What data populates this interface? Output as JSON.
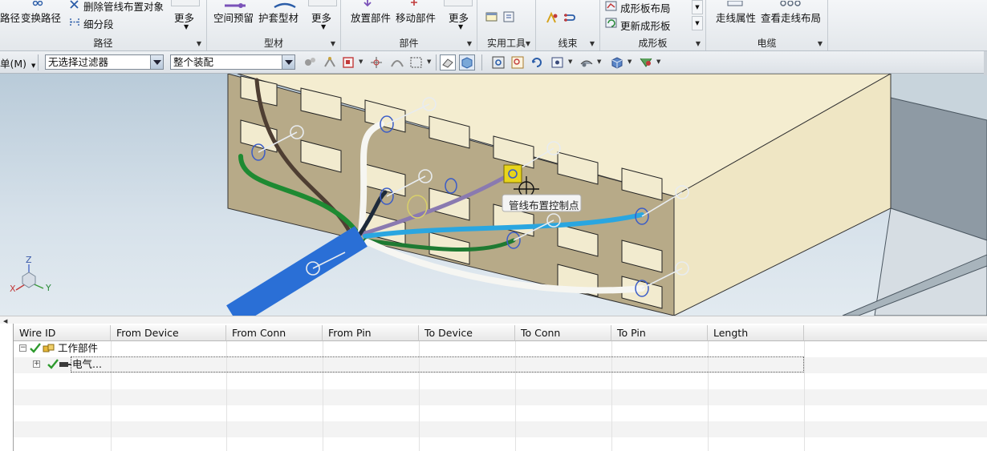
{
  "ribbon": {
    "route_group": {
      "title": "路径",
      "path_label": "路径",
      "transform_path_label": "变换路径",
      "delete_routing_label": "删除管线布置对象",
      "subdivide_label": "细分段",
      "more_label": "更多"
    },
    "profile_group": {
      "title": "型材",
      "space_reserve_label": "空间预留",
      "sleeve_label": "护套型材",
      "more_label": "更多"
    },
    "parts_group": {
      "title": "部件",
      "place_part_label": "放置部件",
      "move_part_label": "移动部件",
      "more_label": "更多"
    },
    "utility_group": {
      "title": "实用工具"
    },
    "harness_group": {
      "title": "线束"
    },
    "formboard_group": {
      "title": "成形板",
      "formboard_layout_label": "成形板布局",
      "update_formboard_label": "更新成形板"
    },
    "cable_group": {
      "title": "电缆",
      "routing_props_label": "走线属性",
      "view_routing_layout_label": "查看走线布局"
    }
  },
  "toolbar": {
    "menu_label": "单(M)",
    "filter_value": "无选择过滤器",
    "scope_value": "整个装配"
  },
  "viewport": {
    "tooltip": "管线布置控制点",
    "axis_z": "Z",
    "axis_x": "X",
    "axis_y": "Y"
  },
  "wire_table": {
    "columns": [
      "Wire ID",
      "From Device",
      "From Conn",
      "From Pin",
      "To Device",
      "To Conn",
      "To Pin",
      "Length"
    ],
    "rows": [
      {
        "label": "工作部件",
        "expanded": true
      },
      {
        "label": "电气...",
        "expanded": false
      }
    ]
  },
  "colors": {
    "ribbon_bg": "#e8ecf0",
    "viewport_bg": "#c8d8e4",
    "panel_face": "#b8ab8a",
    "box_face": "#f3eccd",
    "wire_blue": "#2a6fd6",
    "wire_cyan": "#2aa6e0",
    "wire_green": "#1e8a32",
    "wire_brown": "#5a4638",
    "wire_purple": "#8a7ab0",
    "wire_white": "#f6f6f2",
    "check_green": "#2e9a2e"
  }
}
